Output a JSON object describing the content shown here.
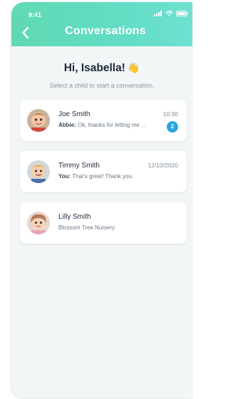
{
  "status_bar": {
    "time": "9:41",
    "signal_icon": "signal-icon",
    "wifi_icon": "wifi-icon",
    "battery_icon": "battery-icon"
  },
  "header": {
    "title": "Conversations",
    "back_icon": "chevron-left-icon",
    "background": "#5fd9b3"
  },
  "greeting": {
    "text": "Hi, Isabella!",
    "emoji": "👋"
  },
  "subtitle": "Select a child to start a conversation.",
  "conversations": [
    {
      "name": "Joe Smith",
      "sender": "Abbie:",
      "message": "Ok, thanks for letting me know.",
      "time": "10:30",
      "unread": "2",
      "avatar": "child-avatar"
    },
    {
      "name": "Timmy Smith",
      "sender": "You:",
      "message": "That's great! Thank you.",
      "time": "12/10/2020",
      "avatar": "child-avatar"
    },
    {
      "name": "Lilly Smith",
      "message": "Blossom Tree Nursery",
      "avatar": "child-avatar"
    }
  ],
  "colors": {
    "accent": "#5fd9b3",
    "badge": "#2aa6e0",
    "title": "#1f2a3a"
  }
}
